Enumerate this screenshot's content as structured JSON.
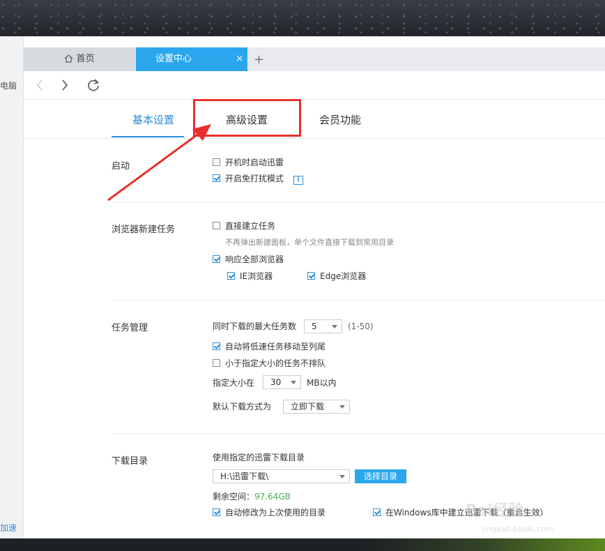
{
  "left_strip": {
    "top_text": "电脑",
    "bottom_text": "加速"
  },
  "tabs": {
    "home": "首页",
    "active": "设置中心",
    "close": "×",
    "new": "+"
  },
  "content_tabs": {
    "basic": "基本设置",
    "advanced": "高级设置",
    "member": "会员功能"
  },
  "sections": {
    "startup": {
      "label": "启动",
      "opt1": "开机时启动迅雷",
      "opt1_checked": false,
      "opt2": "开启免打扰模式",
      "opt2_checked": true
    },
    "browser": {
      "label": "浏览器新建任务",
      "opt1": "直接建立任务",
      "opt1_checked": false,
      "hint": "不再弹出新建面板，单个文件直接下载到常用目录",
      "opt2": "响应全部浏览器",
      "opt2_checked": true,
      "ie": "IE浏览器",
      "edge": "Edge浏览器"
    },
    "task": {
      "label": "任务管理",
      "max_label": "同时下载的最大任务数",
      "max_value": "5",
      "max_range": "(1-50)",
      "opt1": "自动将低速任务移动至列尾",
      "opt1_checked": true,
      "opt2": "小于指定大小的任务不排队",
      "opt2_checked": false,
      "size_label": "指定大小在",
      "size_value": "30",
      "size_unit": "MB以内",
      "mode_label": "默认下载方式为",
      "mode_value": "立即下载"
    },
    "download": {
      "label": "下载目录",
      "use_label": "使用指定的迅雷下载目录",
      "path": "H:\\迅雷下载\\",
      "choose_btn": "选择目录",
      "free_label": "剩余空间：",
      "free_value": "97.64GB",
      "opt1": "自动修改为上次使用的目录",
      "opt1_checked": true,
      "opt2": "在Windows库中建立迅雷下载（重启生效）",
      "opt2_checked": true
    }
  },
  "watermark": {
    "main": "Bai经验",
    "sub": "jingyan.baidu.com"
  },
  "colors": {
    "accent": "#2aa7ec",
    "annotation": "#e8302c",
    "free_space": "#4cae4c"
  }
}
